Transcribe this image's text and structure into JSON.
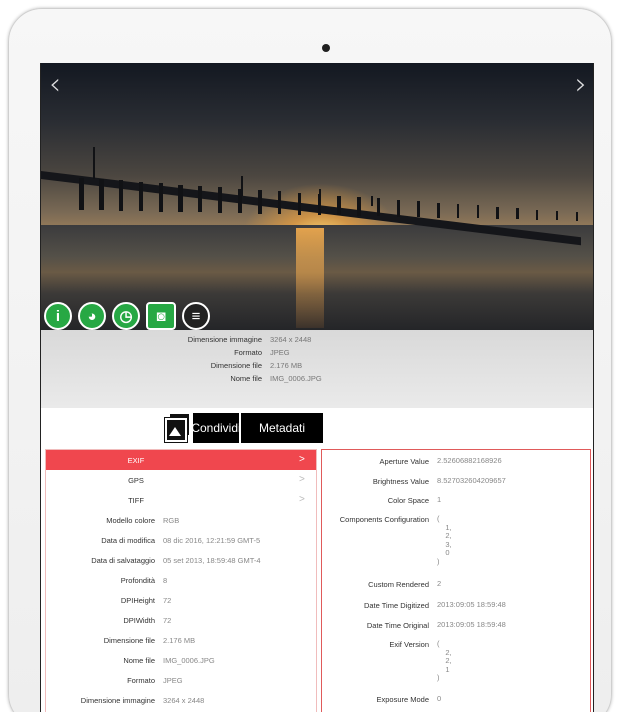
{
  "photo": {
    "prev_arrow": "‹",
    "next_arrow": "›"
  },
  "icons": [
    {
      "name": "info-icon",
      "glyph": "i"
    },
    {
      "name": "globe-icon",
      "glyph": "◕"
    },
    {
      "name": "clock-icon",
      "glyph": "◷"
    },
    {
      "name": "camera-icon",
      "glyph": "◙"
    },
    {
      "name": "comment-icon",
      "glyph": "≡"
    }
  ],
  "info": [
    {
      "key": "Dimensione immagine",
      "value": "3264 x 2448"
    },
    {
      "key": "Formato",
      "value": "JPEG"
    },
    {
      "key": "Dimensione file",
      "value": "2.176 MB"
    },
    {
      "key": "Nome file",
      "value": "IMG_0006.JPG"
    }
  ],
  "toolbar": {
    "share_label": "Condividi",
    "metadata_label": "Metadati"
  },
  "left_panel": {
    "categories": [
      "EXIF",
      "GPS",
      "TIFF"
    ],
    "chevron": ">",
    "rows": [
      {
        "key": "Modello colore",
        "value": "RGB"
      },
      {
        "key": "Data di modifica",
        "value": "08 dic 2016, 12:21:59 GMT-5"
      },
      {
        "key": "Data di salvataggio",
        "value": "05 set 2013, 18:59:48 GMT-4"
      },
      {
        "key": "Profondità",
        "value": "8"
      },
      {
        "key": "DPIHeight",
        "value": "72"
      },
      {
        "key": "DPIWidth",
        "value": "72"
      },
      {
        "key": "Dimensione file",
        "value": "2.176 MB"
      },
      {
        "key": "Nome file",
        "value": "IMG_0006.JPG"
      },
      {
        "key": "Formato",
        "value": "JPEG"
      },
      {
        "key": "Dimensione immagine",
        "value": "3264 x 2448"
      }
    ]
  },
  "right_panel": {
    "rows": [
      {
        "key": "Aperture Value",
        "value": "2.52606882168926"
      },
      {
        "key": "Brightness Value",
        "value": "8.527032604209657"
      },
      {
        "key": "Color Space",
        "value": "1"
      },
      {
        "key": "Components Configuration",
        "value": "(\n    1,\n    2,\n    3,\n    0\n)"
      },
      {
        "key": "Custom Rendered",
        "value": "2"
      },
      {
        "key": "Date Time Digitized",
        "value": "2013:09:05 18:59:48"
      },
      {
        "key": "Date Time Original",
        "value": "2013:09:05 18:59:48"
      },
      {
        "key": "Exif Version",
        "value": "(\n    2,\n    2,\n    1\n)"
      },
      {
        "key": "Exposure Mode",
        "value": "0"
      }
    ]
  },
  "colors": {
    "accent_red": "#f0474e",
    "icon_green": "#27a844"
  }
}
